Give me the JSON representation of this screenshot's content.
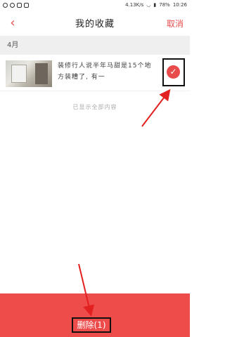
{
  "status_bar": {
    "speed": "4.13K/s",
    "battery": "78%",
    "time": "10:26"
  },
  "header": {
    "back_icon": "chevron-left-icon",
    "title": "我的收藏",
    "cancel_label": "取消"
  },
  "section": {
    "month": "4月"
  },
  "items": [
    {
      "title": "装修行人说半年马甜是15个地方装糟了, 有一",
      "checked": true
    }
  ],
  "footer_note": "已显示全部内容",
  "delete_button": {
    "label": "删除(1)"
  },
  "colors": {
    "accent": "#e84b4b",
    "delete_bar": "#ee4b4b",
    "section_bg": "#efefef"
  }
}
